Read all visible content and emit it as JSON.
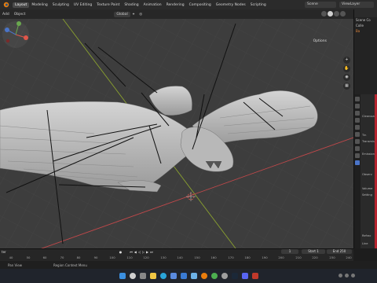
{
  "menubar": {
    "items": [
      {
        "label": "Layout",
        "active": true
      },
      {
        "label": "Modeling"
      },
      {
        "label": "Sculpting"
      },
      {
        "label": "UV Editing"
      },
      {
        "label": "Texture Paint"
      },
      {
        "label": "Shading"
      },
      {
        "label": "Animation"
      },
      {
        "label": "Rendering"
      },
      {
        "label": "Compositing"
      },
      {
        "label": "Geometry Nodes"
      },
      {
        "label": "Scripting"
      }
    ],
    "scene": "Scene",
    "view_layer": "ViewLayer"
  },
  "viewport_header": {
    "add_label": "Add",
    "object_label": "Object",
    "transform_orientation": "Global",
    "options_label": "Options"
  },
  "outliner": {
    "rows": [
      "Scene Co",
      "Colle",
      "Ba"
    ]
  },
  "properties": {
    "labels": [
      "Clearcoat",
      "Tin",
      "Transmiss",
      "Emission",
      "Observ",
      "Volume",
      "Setting",
      "Refrac",
      "Line"
    ]
  },
  "timeline": {
    "menu_label": "ter",
    "current_frame": "1",
    "start_label": "Start",
    "start_value": "1",
    "end_label": "End",
    "end_value": "250",
    "ticks": [
      "60",
      "70",
      "80",
      "90",
      "100",
      "110",
      "120",
      "130",
      "140",
      "150",
      "160",
      "170",
      "180",
      "190",
      "200",
      "210",
      "220",
      "230",
      "240",
      "250"
    ],
    "first_tick": "40",
    "second_tick": "50"
  },
  "statusbar": {
    "items": [
      "Pan View",
      "Region Context Menu"
    ]
  },
  "taskbar": {
    "time": "",
    "icons": [
      "start",
      "search",
      "taskview",
      "explorer",
      "edge",
      "store",
      "mail",
      "photos",
      "blender",
      "chrome",
      "settings",
      "steam",
      "discord",
      "app1"
    ]
  },
  "colors": {
    "accent": "#4a74c8",
    "viewport_bg": "#3d3d3d",
    "x_axis": "#c0484a",
    "y_axis": "#8aa12f",
    "mesh": "#bdbdbd"
  }
}
